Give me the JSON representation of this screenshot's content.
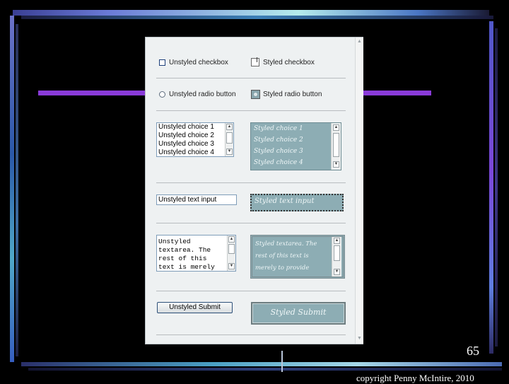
{
  "slide": {
    "number": "65",
    "copyright": "copyright Penny McIntire, 2010"
  },
  "form": {
    "checkboxes": {
      "unstyled_label": "Unstyled checkbox",
      "styled_label": "Styled checkbox"
    },
    "radios": {
      "unstyled_label": "Unstyled radio button",
      "styled_label": "Styled radio button"
    },
    "unstyled_select": {
      "options": [
        "Unstyled choice 1",
        "Unstyled choice 2",
        "Unstyled choice 3",
        "Unstyled choice 4"
      ]
    },
    "styled_select": {
      "options": [
        "Styled choice 1",
        "Styled choice 2",
        "Styled choice 3",
        "Styled choice 4"
      ]
    },
    "text_inputs": {
      "unstyled_value": "Unstyled text input",
      "styled_value": "Styled text input"
    },
    "textareas": {
      "unstyled_value": "Unstyled\ntextarea. The\nrest of this\ntext is merely",
      "styled_value": "Styled textarea. The rest of this text is merely to provide"
    },
    "buttons": {
      "unstyled_label": "Unstyled Submit",
      "styled_label": "Styled Submit"
    }
  },
  "colors": {
    "styled_fill": "#8dadb4",
    "accent_bar": "#8a3bd9",
    "background": "#000000"
  }
}
